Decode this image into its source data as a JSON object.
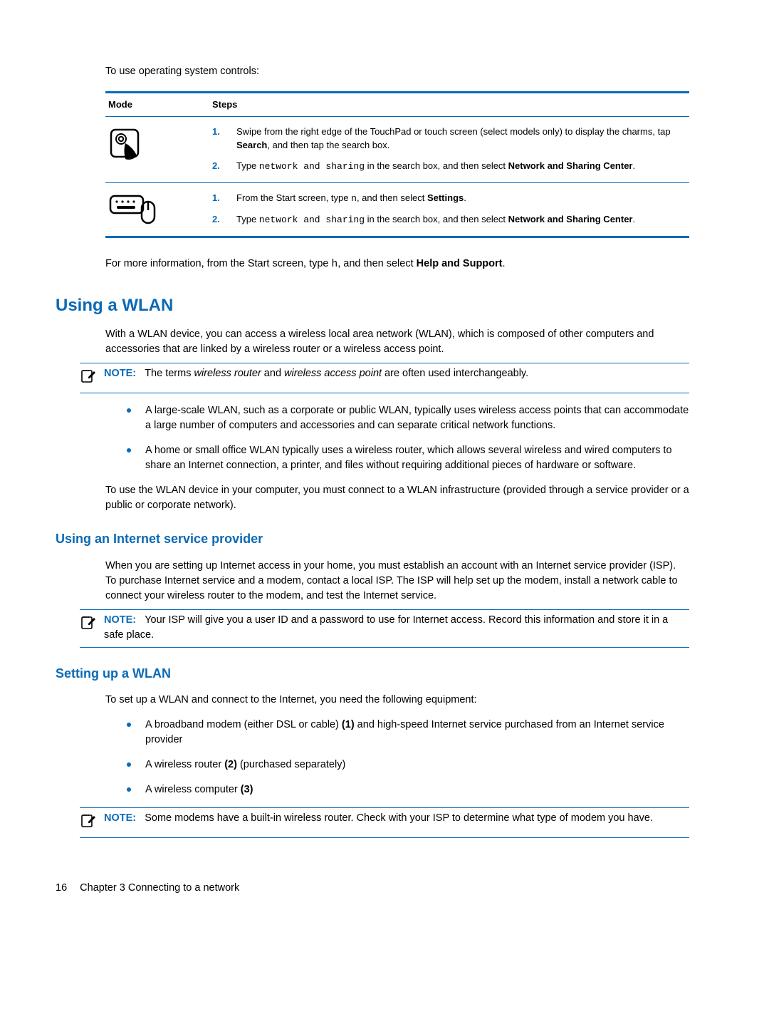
{
  "intro": "To use operating system controls:",
  "table": {
    "head_mode": "Mode",
    "head_steps": "Steps",
    "rows": [
      {
        "step1": {
          "num": "1.",
          "pre": "Swipe from the right edge of the TouchPad or touch screen (select models only) to display the charms, tap ",
          "b1": "Search",
          "post": ", and then tap the search box."
        },
        "step2": {
          "num": "2.",
          "pre": "Type ",
          "mono": "network and sharing",
          "mid": " in the search box, and then select ",
          "b1": "Network and Sharing Center",
          "post": "."
        }
      },
      {
        "step1": {
          "num": "1.",
          "pre": "From the Start screen, type ",
          "mono": "n",
          "mid": ", and then select ",
          "b1": "Settings",
          "post": "."
        },
        "step2": {
          "num": "2.",
          "pre": "Type ",
          "mono": "network and sharing",
          "mid": " in the search box, and then select ",
          "b1": "Network and Sharing Center",
          "post": "."
        }
      }
    ]
  },
  "moreinfo": {
    "pre": "For more information, from the Start screen, type ",
    "mono": "h",
    "mid": ", and then select ",
    "b1": "Help and Support",
    "post": "."
  },
  "h2_wlan": "Using a WLAN",
  "wlan_intro": "With a WLAN device, you can access a wireless local area network (WLAN), which is composed of other computers and accessories that are linked by a wireless router or a wireless access point.",
  "note1": {
    "label": "NOTE:",
    "pre": "The terms ",
    "i1": "wireless router",
    "mid": " and ",
    "i2": "wireless access point",
    "post": " are often used interchangeably."
  },
  "wlan_bullets": [
    "A large-scale WLAN, such as a corporate or public WLAN, typically uses wireless access points that can accommodate a large number of computers and accessories and can separate critical network functions.",
    "A home or small office WLAN typically uses a wireless router, which allows several wireless and wired computers to share an Internet connection, a printer, and files without requiring additional pieces of hardware or software."
  ],
  "wlan_para2": "To use the WLAN device in your computer, you must connect to a WLAN infrastructure (provided through a service provider or a public or corporate network).",
  "h3_isp": "Using an Internet service provider",
  "isp_para": "When you are setting up Internet access in your home, you must establish an account with an Internet service provider (ISP). To purchase Internet service and a modem, contact a local ISP. The ISP will help set up the modem, install a network cable to connect your wireless router to the modem, and test the Internet service.",
  "note2": {
    "label": "NOTE:",
    "body": "Your ISP will give you a user ID and a password to use for Internet access. Record this information and store it in a safe place."
  },
  "h3_setup": "Setting up a WLAN",
  "setup_intro": "To set up a WLAN and connect to the Internet, you need the following equipment:",
  "setup_bullets": [
    {
      "pre": "A broadband modem (either DSL or cable) ",
      "b": "(1)",
      "post": " and high-speed Internet service purchased from an Internet service provider"
    },
    {
      "pre": "A wireless router ",
      "b": "(2)",
      "post": " (purchased separately)"
    },
    {
      "pre": "A wireless computer ",
      "b": "(3)",
      "post": ""
    }
  ],
  "note3": {
    "label": "NOTE:",
    "body": "Some modems have a built-in wireless router. Check with your ISP to determine what type of modem you have."
  },
  "footer": {
    "page": "16",
    "chapter": "Chapter 3   Connecting to a network"
  }
}
